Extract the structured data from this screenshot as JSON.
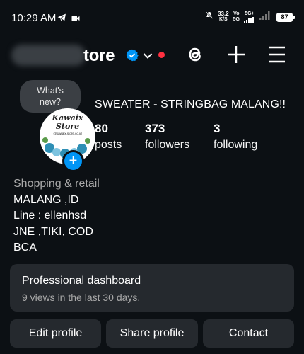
{
  "status_bar": {
    "time": "10:29 AM",
    "speed_value": "33.2",
    "speed_unit": "K/S",
    "net1_top": "Vo",
    "net1_bottom": "5G",
    "net2_top": "5G+",
    "battery": "87"
  },
  "header": {
    "username_visible": "tore"
  },
  "profile": {
    "notes_bubble": [
      "What's",
      "new?"
    ],
    "avatar_text": [
      "Kawaix",
      "Store",
      "@kawaix.store.co.id"
    ],
    "name": "SWEATER - STRINGBAG MALANG!!",
    "stats": [
      {
        "value": "80",
        "label": "posts"
      },
      {
        "value": "373",
        "label": "followers"
      },
      {
        "value": "3",
        "label": "following"
      }
    ],
    "category": "Shopping & retail",
    "bio_lines": [
      "MALANG ,ID",
      "Line : ellenhsd",
      "JNE ,TIKI, COD",
      "BCA"
    ]
  },
  "dashboard": {
    "title": "Professional dashboard",
    "subtitle": "9 views in the last 30 days."
  },
  "buttons": {
    "edit": "Edit profile",
    "share": "Share profile",
    "contact": "Contact"
  },
  "colors": {
    "background": "#0c1014",
    "card": "#25292e",
    "accent": "#0095f6",
    "notification": "#ff3040"
  }
}
